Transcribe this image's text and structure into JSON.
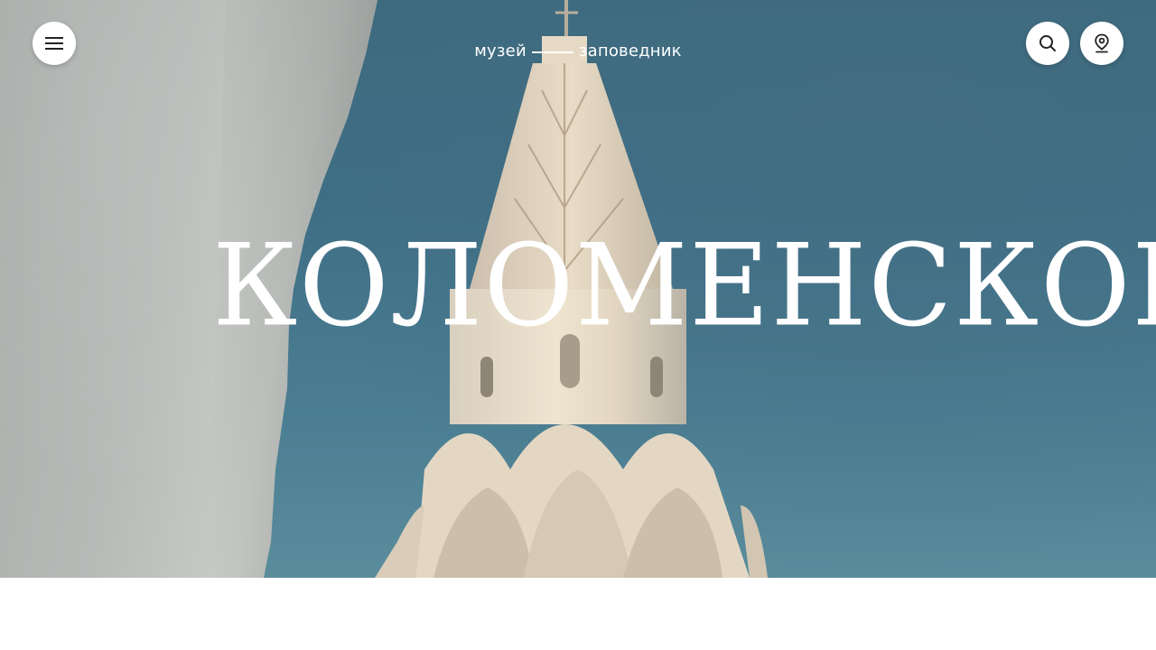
{
  "header": {
    "brand_left": "музей",
    "brand_right": "заповедник",
    "menu_icon": "hamburger-menu-icon",
    "search_icon": "search-icon",
    "location_icon": "location-pin-icon"
  },
  "hero": {
    "title": "КОЛОМЕНСКОЕ",
    "image_alt": "Church of the Ascension, Kolomenskoye"
  },
  "colors": {
    "button_bg": "#ffffff",
    "icon": "#222222",
    "sky": "#3e6e85",
    "text": "#ffffff"
  }
}
